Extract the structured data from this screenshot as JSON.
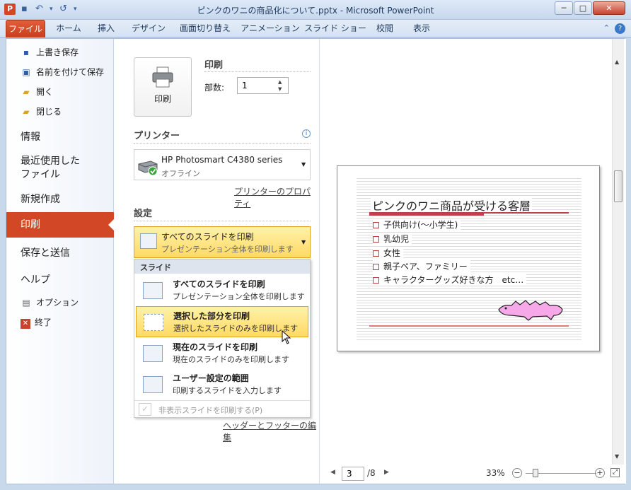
{
  "window": {
    "title": "ピンクのワニの商品化について.pptx - Microsoft PowerPoint",
    "app_icon": "P",
    "controls": [
      "─",
      "□",
      "✕"
    ]
  },
  "ribbon": {
    "tabs": [
      "ファイル",
      "ホーム",
      "挿入",
      "デザイン",
      "画面切り替え",
      "アニメーション",
      "スライド ショー",
      "校閲",
      "表示"
    ],
    "help": "?"
  },
  "nav": {
    "save": "上書き保存",
    "save_as": "名前を付けて保存",
    "open": "開く",
    "close": "閉じる",
    "info": "情報",
    "recent_line1": "最近使用した",
    "recent_line2": "ファイル",
    "new": "新規作成",
    "print": "印刷",
    "save_send": "保存と送信",
    "help": "ヘルプ",
    "options": "オプション",
    "exit": "終了"
  },
  "print": {
    "button_label": "印刷",
    "header": "印刷",
    "copies_label": "部数:",
    "copies_value": "1",
    "printer_header": "プリンター",
    "info_icon": "i",
    "printer_name": "HP Photosmart C4380 series",
    "printer_status": "オフライン",
    "printer_properties": "プリンターのプロパティ",
    "settings_header": "設定",
    "selected_title": "すべてのスライドを印刷",
    "selected_sub": "プレゼンテーション全体を印刷します",
    "header_footer_link": "ヘッダーとフッターの編集"
  },
  "dropdown": {
    "section": "スライド",
    "options": [
      {
        "title": "すべてのスライドを印刷",
        "sub": "プレゼンテーション全体を印刷します"
      },
      {
        "title": "選択した部分を印刷",
        "sub": "選択したスライドのみを印刷します"
      },
      {
        "title": "現在のスライドを印刷",
        "sub": "現在のスライドのみを印刷します"
      },
      {
        "title": "ユーザー設定の範囲",
        "sub": "印刷するスライドを入力します"
      }
    ],
    "hidden_slides": "非表示スライドを印刷する(P)"
  },
  "preview": {
    "slide_title": "ピンクのワニ商品が受ける客層",
    "bullets": [
      "子供向け(～小学生)",
      "乳幼児",
      "女性",
      "親子ペア、ファミリー",
      "キャラクターグッズ好きな方　etc…"
    ],
    "page_current": "3",
    "page_total": "/8",
    "zoom": "33%",
    "zoom_minus": "−",
    "zoom_plus": "+",
    "accent": "#c43d4b",
    "croc_color": "#f7a8e8"
  }
}
